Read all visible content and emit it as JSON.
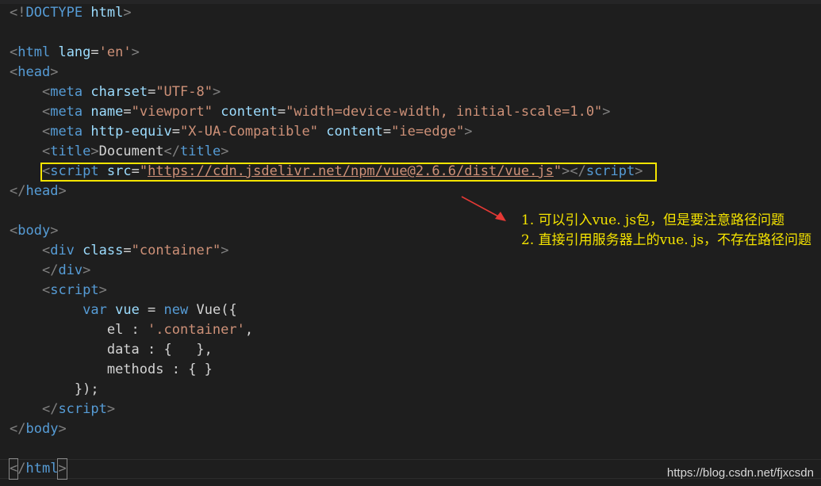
{
  "code": {
    "l1": {
      "open": "<!",
      "tag": "DOCTYPE",
      "sp": " ",
      "attr": "html",
      "close": ">"
    },
    "l3": {
      "open": "<",
      "tag": "html",
      "sp": " ",
      "attr": "lang",
      "eq": "=",
      "val": "'en'",
      "close": ">"
    },
    "l4": {
      "open": "<",
      "tag": "head",
      "close": ">"
    },
    "l5": {
      "indent": "    ",
      "open": "<",
      "tag": "meta",
      "sp": " ",
      "attr": "charset",
      "eq": "=",
      "val": "\"UTF-8\"",
      "close": ">"
    },
    "l6": {
      "indent": "    ",
      "open": "<",
      "tag": "meta",
      "sp": " ",
      "attr1": "name",
      "eq1": "=",
      "val1": "\"viewport\"",
      "sp2": " ",
      "attr2": "content",
      "eq2": "=",
      "val2": "\"width=device-width, initial-scale=1.0\"",
      "close": ">"
    },
    "l7": {
      "indent": "    ",
      "open": "<",
      "tag": "meta",
      "sp": " ",
      "attr1": "http-equiv",
      "eq1": "=",
      "val1": "\"X-UA-Compatible\"",
      "sp2": " ",
      "attr2": "content",
      "eq2": "=",
      "val2": "\"ie=edge\"",
      "close": ">"
    },
    "l8": {
      "indent": "    ",
      "open": "<",
      "tag": "title",
      "close": ">",
      "text": "Document",
      "open2": "</",
      "tag2": "title",
      "close2": ">"
    },
    "l9": {
      "indent": "    ",
      "open": "<",
      "tag": "script",
      "sp": " ",
      "attr": "src",
      "eq": "=",
      "q1": "\"",
      "url": "https://cdn.jsdelivr.net/npm/vue@2.6.6/dist/vue.js",
      "q2": "\"",
      "close": ">",
      "open2": "</",
      "tag2": "script",
      "close2": ">"
    },
    "l10": {
      "open": "</",
      "tag": "head",
      "close": ">"
    },
    "l12": {
      "open": "<",
      "tag": "body",
      "close": ">"
    },
    "l13": {
      "indent": "    ",
      "open": "<",
      "tag": "div",
      "sp": " ",
      "attr": "class",
      "eq": "=",
      "val": "\"container\"",
      "close": ">"
    },
    "l14": {
      "indent": "    ",
      "open": "</",
      "tag": "div",
      "close": ">"
    },
    "l15": {
      "indent": "    ",
      "open": "<",
      "tag": "script",
      "close": ">"
    },
    "l16": {
      "indent": "         ",
      "kw": "var",
      "sp": " ",
      "var": "vue",
      "eq": " = ",
      "kw2": "new",
      "sp2": " ",
      "cls": "Vue",
      "rest": "({"
    },
    "l17": {
      "indent": "            ",
      "key": "el",
      "sep": " : ",
      "val": "'.container'",
      "rest": ","
    },
    "l18": {
      "indent": "            ",
      "key": "data",
      "rest": " : {   },"
    },
    "l19": {
      "indent": "            ",
      "key": "methods",
      "rest": " : { }"
    },
    "l20": {
      "indent": "        ",
      "rest": "});"
    },
    "l21": {
      "indent": "    ",
      "open": "</",
      "tag": "script",
      "close": ">"
    },
    "l22": {
      "open": "</",
      "tag": "body",
      "close": ">"
    },
    "l24": {
      "open": "<",
      "open2": "/",
      "tag": "html",
      "close": ">"
    }
  },
  "annotation": {
    "line1": "1. 可以引入vue. js包，但是要注意路径问题",
    "line2": "2. 直接引用服务器上的vue. js，不存在路径问题"
  },
  "watermark": "https://blog.csdn.net/fjxcsdn",
  "colors": {
    "background": "#1e1e1e",
    "tag": "#569cd6",
    "attribute": "#9cdcfe",
    "string": "#ce9178",
    "punctuation": "#808080",
    "highlight_box": "#f5e400",
    "annotation_text": "#f5e400",
    "arrow": "#e53935"
  }
}
